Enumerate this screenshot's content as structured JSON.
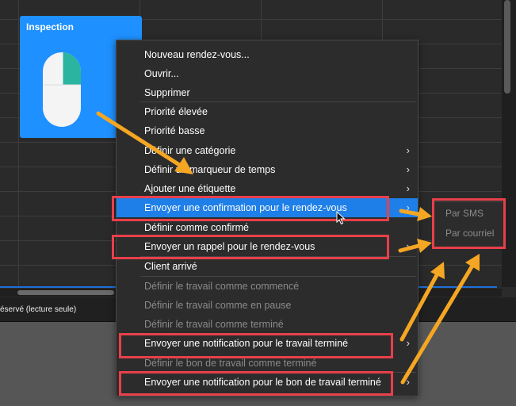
{
  "appointment": {
    "title": "Inspection",
    "icon": "mouse-icon"
  },
  "status_bar": {
    "text": "éservé (lecture seule)"
  },
  "context_menu": {
    "items": [
      {
        "label": "Nouveau rendez-vous...",
        "enabled": true,
        "submenu": false
      },
      {
        "label": "Ouvrir...",
        "enabled": true,
        "submenu": false
      },
      {
        "label": "Supprimer",
        "enabled": true,
        "submenu": false
      },
      {
        "label": "Priorité élevée",
        "enabled": true,
        "submenu": false
      },
      {
        "label": "Priorité basse",
        "enabled": true,
        "submenu": false
      },
      {
        "label": "Définir une catégorie",
        "enabled": true,
        "submenu": true
      },
      {
        "label": "Définir un marqueur de temps",
        "enabled": true,
        "submenu": true
      },
      {
        "label": "Ajouter une étiquette",
        "enabled": true,
        "submenu": true
      },
      {
        "label": "Envoyer une confirmation pour le rendez-vous",
        "enabled": true,
        "submenu": true,
        "highlighted": true
      },
      {
        "label": "Définir comme confirmé",
        "enabled": true,
        "submenu": false
      },
      {
        "label": "Envoyer un rappel pour le rendez-vous",
        "enabled": true,
        "submenu": true
      },
      {
        "label": "Client arrivé",
        "enabled": true,
        "submenu": false
      },
      {
        "label": "Définir le travail comme commencé",
        "enabled": false,
        "submenu": false
      },
      {
        "label": "Définir le travail comme en pause",
        "enabled": false,
        "submenu": false
      },
      {
        "label": "Définir le travail comme terminé",
        "enabled": false,
        "submenu": false
      },
      {
        "label": "Envoyer une notification pour le travail terminé",
        "enabled": true,
        "submenu": true
      },
      {
        "label": "Définir le bon de travail comme terminé",
        "enabled": false,
        "submenu": false
      },
      {
        "label": "Envoyer une notification pour le bon de travail terminé",
        "enabled": true,
        "submenu": true
      }
    ]
  },
  "submenu": {
    "items": [
      {
        "label": "Par SMS",
        "enabled": false
      },
      {
        "label": "Par courriel",
        "enabled": false
      }
    ]
  },
  "colors": {
    "highlight": "#1e7fe8",
    "appointment": "#1e90ff",
    "annotation_box": "#e8404a",
    "annotation_arrow": "#f5a623"
  }
}
